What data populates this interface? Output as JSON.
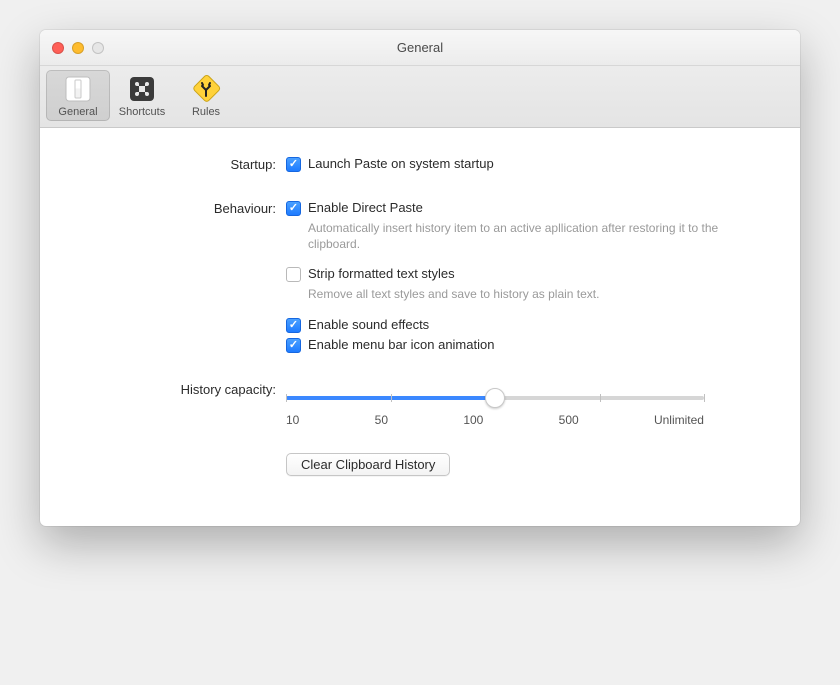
{
  "window": {
    "title": "General"
  },
  "tabs": [
    {
      "label": "General"
    },
    {
      "label": "Shortcuts"
    },
    {
      "label": "Rules"
    }
  ],
  "sections": {
    "startup": {
      "label": "Startup:",
      "launch": {
        "label": "Launch Paste on system startup",
        "checked": true
      }
    },
    "behaviour": {
      "label": "Behaviour:",
      "direct_paste": {
        "label": "Enable Direct Paste",
        "checked": true,
        "description": "Automatically insert history item to an active apllication after restoring it to the clipboard."
      },
      "strip": {
        "label": "Strip formatted text styles",
        "checked": false,
        "description": "Remove all text styles and save to history as plain text."
      },
      "sound": {
        "label": "Enable sound effects",
        "checked": true
      },
      "menu_anim": {
        "label": "Enable menu bar icon animation",
        "checked": true
      }
    },
    "history": {
      "label": "History capacity:",
      "ticks": [
        "10",
        "50",
        "100",
        "500",
        "Unlimited"
      ],
      "value_index": 2
    },
    "clear_button": "Clear Clipboard History"
  }
}
